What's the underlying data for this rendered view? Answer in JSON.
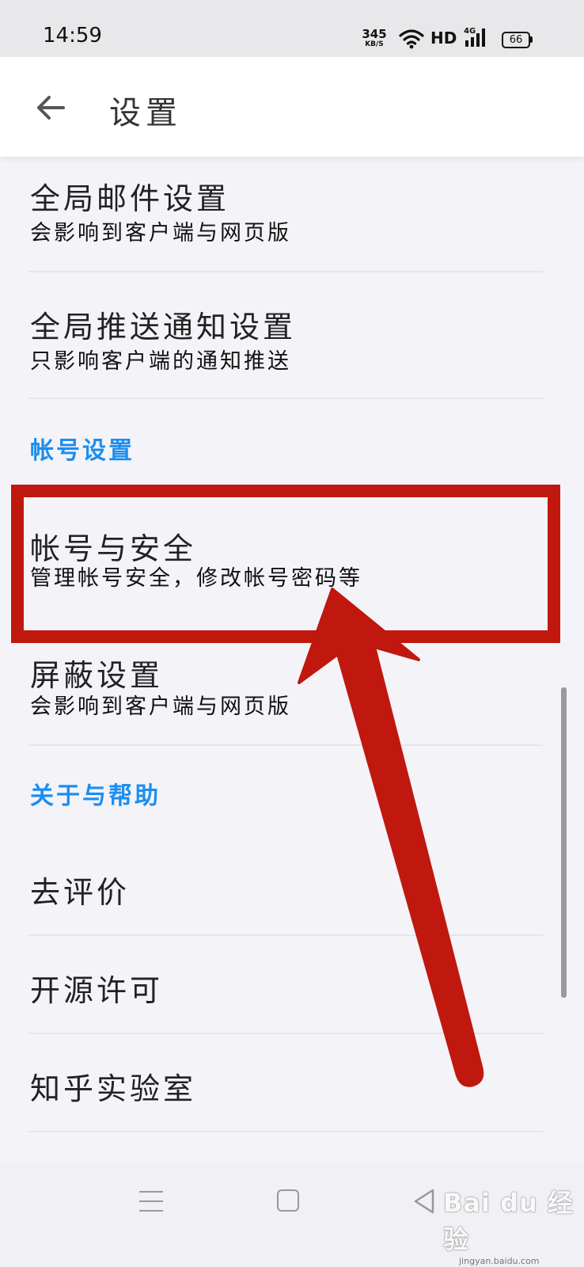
{
  "status_bar": {
    "time": "14:59",
    "speed_value": "345",
    "speed_unit": "KB/S",
    "hd": "HD",
    "network": "4G",
    "battery": "66"
  },
  "app_bar": {
    "back_icon": "back-arrow-icon",
    "title": "设置"
  },
  "items": [
    {
      "title": "全局邮件设置",
      "subtitle": "会影响到客户端与网页版"
    },
    {
      "title": "全局推送通知设置",
      "subtitle": "只影响客户端的通知推送"
    },
    {
      "title": "帐号与安全",
      "subtitle": "管理帐号安全，修改帐号密码等"
    },
    {
      "title": "屏蔽设置",
      "subtitle": "会影响到客户端与网页版"
    },
    {
      "title": "去评价"
    },
    {
      "title": "开源许可"
    },
    {
      "title": "知乎实验室"
    }
  ],
  "sections": {
    "account": "帐号设置",
    "about": "关于与帮助"
  },
  "colors": {
    "accent": "#1c8ef0",
    "annotation": "#c0180e"
  },
  "nav_bar": {
    "icons": [
      "menu-icon",
      "home-icon",
      "back-triangle-icon"
    ]
  },
  "watermark": {
    "brand": "Bai du 经验",
    "url": "jingyan.baidu.com"
  }
}
